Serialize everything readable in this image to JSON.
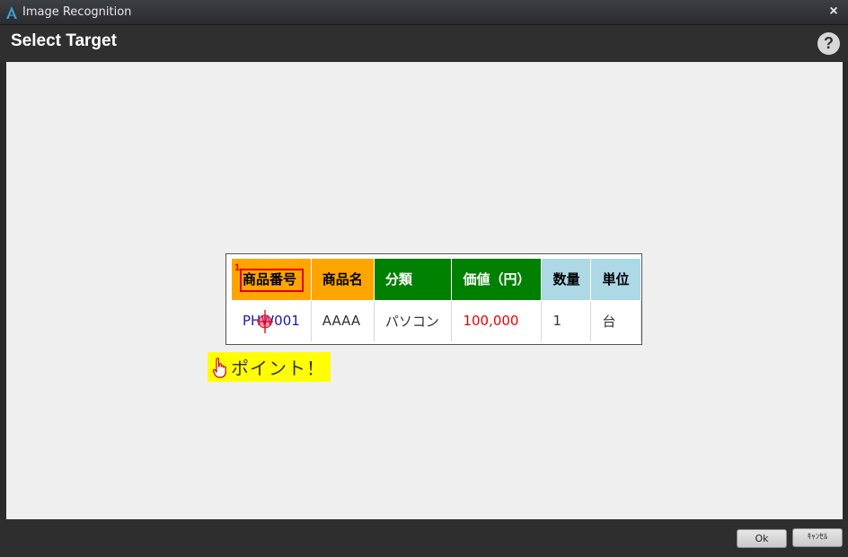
{
  "window": {
    "title": "Image Recognition",
    "close_label": "×",
    "app_icon": "app-logo-icon"
  },
  "header": {
    "title": "Select Target",
    "help_label": "?"
  },
  "target": {
    "columns": [
      "商品番号",
      "商品名",
      "分類",
      "価値（円）",
      "数量",
      "単位"
    ],
    "row": [
      "PHW001",
      "AAAA",
      "パソコン",
      "100,000",
      "1",
      "台"
    ],
    "selection_index": "1",
    "header_colors": {
      "orange": "#ffa500",
      "green": "#008000",
      "blue": "#add8e6"
    },
    "value_colors": {
      "code": "#1a1aaa",
      "price": "#ee0000"
    },
    "selection_color": "#e00000"
  },
  "point": {
    "label": "ポイント！",
    "icon": "pointing-hand-icon",
    "background": "#ffff00"
  },
  "footer": {
    "ok_label": "Ok",
    "cancel_label": "ｷｬﾝｾﾙ"
  }
}
